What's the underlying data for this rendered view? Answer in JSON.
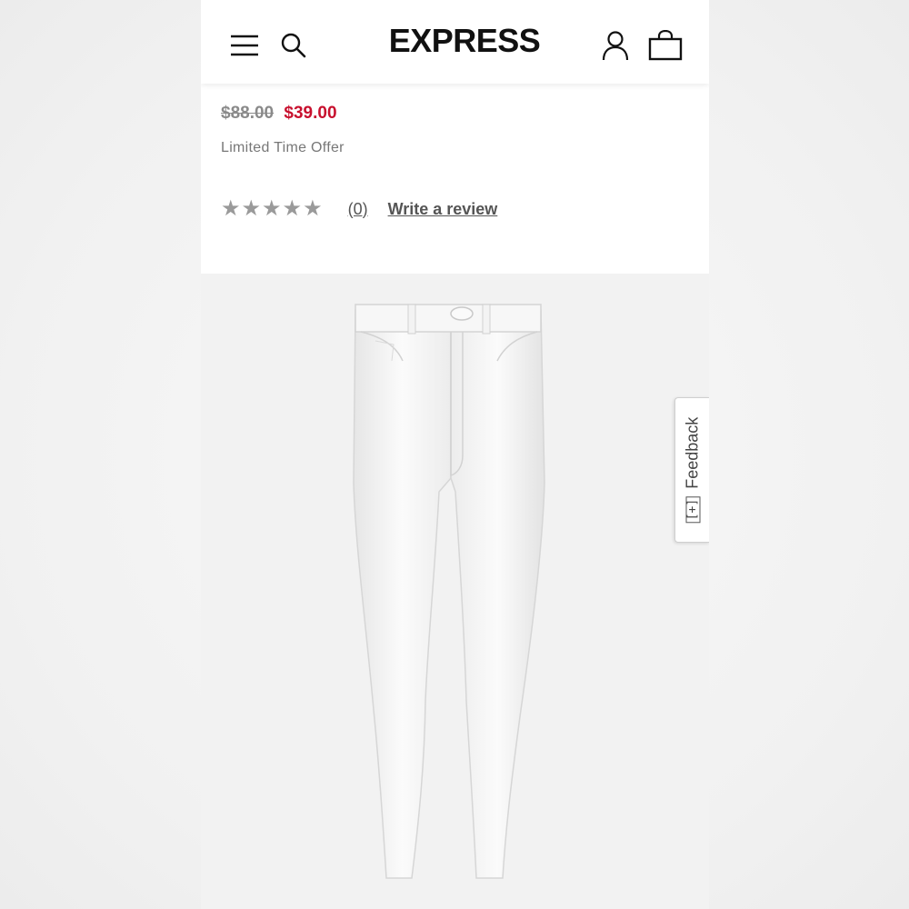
{
  "header": {
    "logo": "EXPRESS",
    "menu_icon": "hamburger-menu-icon",
    "search_icon": "search-icon",
    "account_icon": "user-account-icon",
    "bag_icon": "shopping-bag-icon"
  },
  "product": {
    "original_price": "$88.00",
    "sale_price": "$39.00",
    "offer_text": "Limited Time Offer",
    "rating": 0,
    "max_rating": 5,
    "stars": [
      "★",
      "★",
      "★",
      "★",
      "★"
    ],
    "review_count": "(0)",
    "write_review": "Write a review"
  },
  "feedback": {
    "label": "Feedback",
    "icon_glyph": "[+]"
  },
  "colors": {
    "sale_price": "#c8102e",
    "original_price": "#8a8a8a",
    "star": "#9a9a9a"
  }
}
